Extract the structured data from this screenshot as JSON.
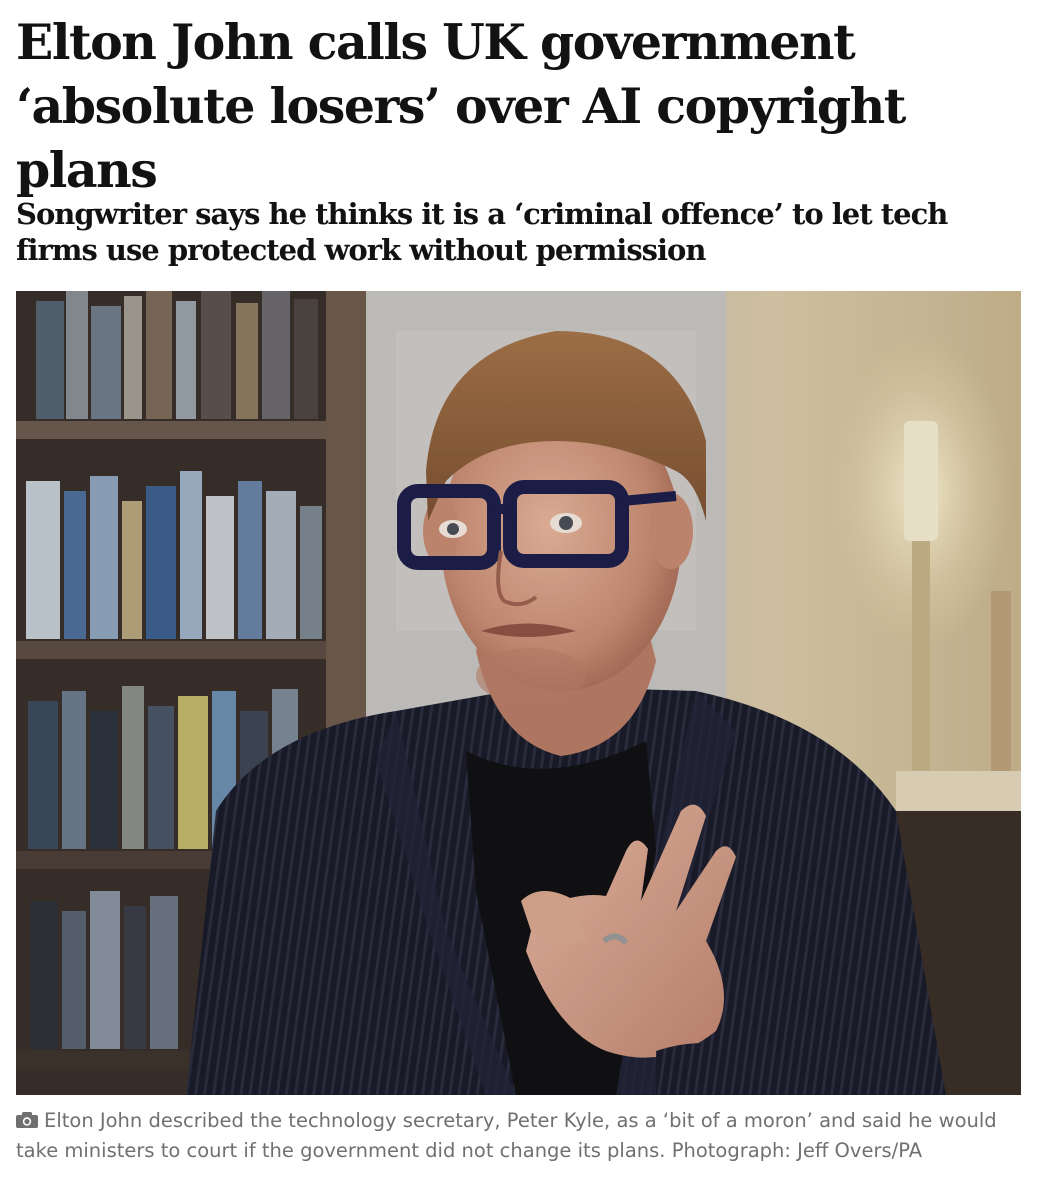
{
  "article": {
    "headline": "Elton John calls UK government ‘absolute losers’ over AI copyright plans",
    "standfirst": "Songwriter says he thinks it is a ‘criminal offence’ to let tech firms use protected work without permission",
    "image": {
      "subject": "elton-john-interview-photo"
    },
    "caption": {
      "icon": "camera-icon",
      "text": "Elton John described the technology secretary, Peter Kyle, as a ‘bit of a moron’ and said he would take ministers to court if the government did not change its plans. Photograph: Jeff Overs/PA"
    }
  },
  "colors": {
    "headline_text": "#121212",
    "caption_text": "#707070",
    "background": "#ffffff"
  }
}
